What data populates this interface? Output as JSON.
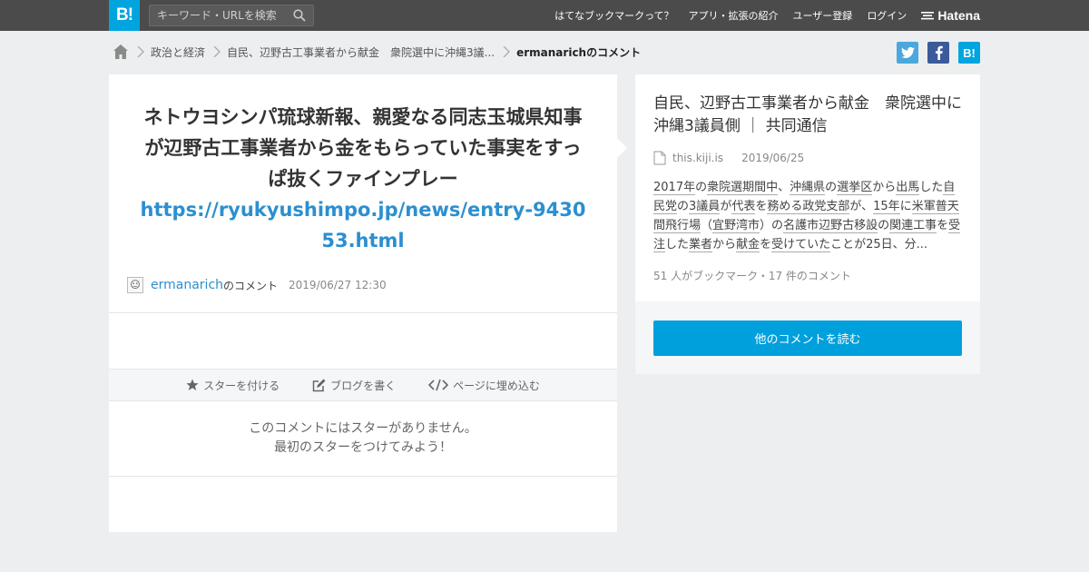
{
  "header": {
    "logo_text": "B!",
    "search_placeholder": "キーワード・URLを検索",
    "nav": [
      "はてなブックマークって？",
      "アプリ・拡張の紹介",
      "ユーザー登録",
      "ログイン"
    ],
    "brand": "Hatena"
  },
  "breadcrumb": {
    "items": [
      "政治と経済",
      "自民、辺野古工事業者から献金　衆院選中に沖縄3議..."
    ],
    "current": "ermanarichのコメント"
  },
  "share": {
    "twitter": "t",
    "facebook": "f",
    "hatena": "B!"
  },
  "comment": {
    "text": "ネトウヨシンパ琉球新報、親愛なる同志玉城県知事が辺野古工事業者から金をもらっていた事実をすっぱ抜くファインプレー",
    "link": "https://ryukyushimpo.jp/news/entry-943053.html",
    "author": "ermanarich",
    "author_suffix": "のコメント",
    "date": "2019/06/27 12:30"
  },
  "actions": {
    "star": "スターを付ける",
    "blog": "ブログを書く",
    "embed": "ページに埋め込む"
  },
  "no_star": {
    "line1": "このコメントにはスターがありません。",
    "line2": "最初のスターをつけてみよう！"
  },
  "entry": {
    "title": "自民、辺野古工事業者から献金　衆院選中に沖縄3議員側 ｜ 共同通信",
    "domain": "this.kiji.is",
    "date": "2019/06/25",
    "summary_parts": [
      {
        "t": "2017年",
        "u": true
      },
      {
        "t": "の",
        "u": false
      },
      {
        "t": "衆院選",
        "u": true
      },
      {
        "t": "期間中",
        "u": true
      },
      {
        "t": "、",
        "u": false
      },
      {
        "t": "沖縄県",
        "u": true
      },
      {
        "t": "の",
        "u": false
      },
      {
        "t": "選挙区",
        "u": true
      },
      {
        "t": "から",
        "u": false
      },
      {
        "t": "出馬",
        "u": true
      },
      {
        "t": "した",
        "u": false
      },
      {
        "t": "自民党",
        "u": true
      },
      {
        "t": "の",
        "u": false
      },
      {
        "t": "3議員",
        "u": true
      },
      {
        "t": "が",
        "u": false
      },
      {
        "t": "代表",
        "u": true
      },
      {
        "t": "を",
        "u": false
      },
      {
        "t": "務める",
        "u": true
      },
      {
        "t": "政党支部",
        "u": true
      },
      {
        "t": "が、",
        "u": false
      },
      {
        "t": "15年",
        "u": true
      },
      {
        "t": "に",
        "u": false
      },
      {
        "t": "米軍普天間飛行場",
        "u": true
      },
      {
        "t": "（",
        "u": false
      },
      {
        "t": "宜野湾市",
        "u": true
      },
      {
        "t": "）の",
        "u": false
      },
      {
        "t": "名護市辺野古移設",
        "u": true
      },
      {
        "t": "の",
        "u": false
      },
      {
        "t": "関連工事",
        "u": true
      },
      {
        "t": "を",
        "u": false
      },
      {
        "t": "受注",
        "u": true
      },
      {
        "t": "した",
        "u": false
      },
      {
        "t": "業者",
        "u": true
      },
      {
        "t": "から",
        "u": false
      },
      {
        "t": "献金",
        "u": true
      },
      {
        "t": "を",
        "u": false
      },
      {
        "t": "受けていた",
        "u": true
      },
      {
        "t": "ことが25日、分...",
        "u": false
      }
    ],
    "stats": "51 人がブックマーク・17 件のコメント"
  },
  "more_button": "他のコメントを読む",
  "colors": {
    "accent": "#00a4de",
    "topbar": "#4b4b4b",
    "link": "#2c8fd0"
  }
}
